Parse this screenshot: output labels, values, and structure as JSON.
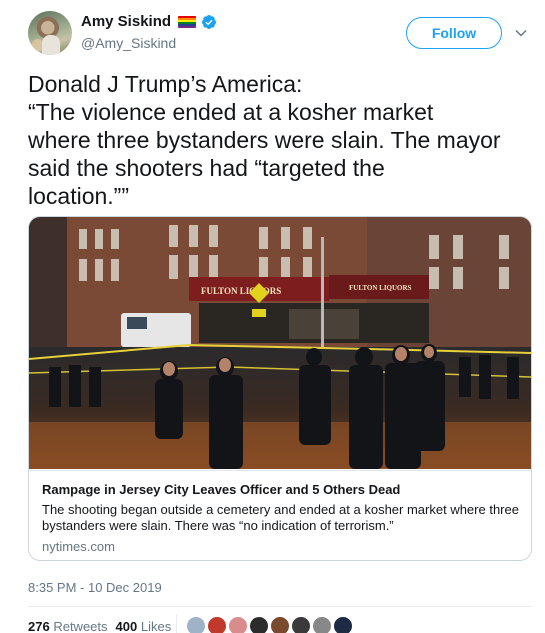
{
  "author": {
    "name": "Amy Siskind",
    "handle": "@Amy_Siskind",
    "flag_colors": [
      "#e40303",
      "#ff8c00",
      "#ffed00",
      "#008026",
      "#24408e",
      "#732982"
    ],
    "verified_icon": "verified-badge-icon",
    "verified_color": "#1da1f2"
  },
  "follow_label": "Follow",
  "tweet_lines": [
    "Donald J Trump’s America:",
    "“The violence ended at a kosher market",
    "where three bystanders were slain. The mayor",
    "said the shooters had “targeted the",
    "location.””"
  ],
  "card": {
    "image_signs": [
      "FULTON LIQUORS",
      "FULTON LIQUORS"
    ],
    "title": "Rampage in Jersey City Leaves Officer and 5 Others Dead",
    "description": "The shooting began outside a cemetery and ended at a kosher market where three bystanders were slain. There was “no indication of terrorism.”",
    "domain": "nytimes.com"
  },
  "timestamp": "8:35 PM - 10 Dec 2019",
  "stats": {
    "retweets_count": "276",
    "retweets_label": "Retweets",
    "likes_count": "400",
    "likes_label": "Likes"
  },
  "liker_avatar_colors": [
    "#9fb3c8",
    "#c0392b",
    "#d98c8c",
    "#2c2c2c",
    "#7a4a2e",
    "#3a3a3a",
    "#888888",
    "#1f2a44"
  ],
  "accent_color": "#1da1f2"
}
